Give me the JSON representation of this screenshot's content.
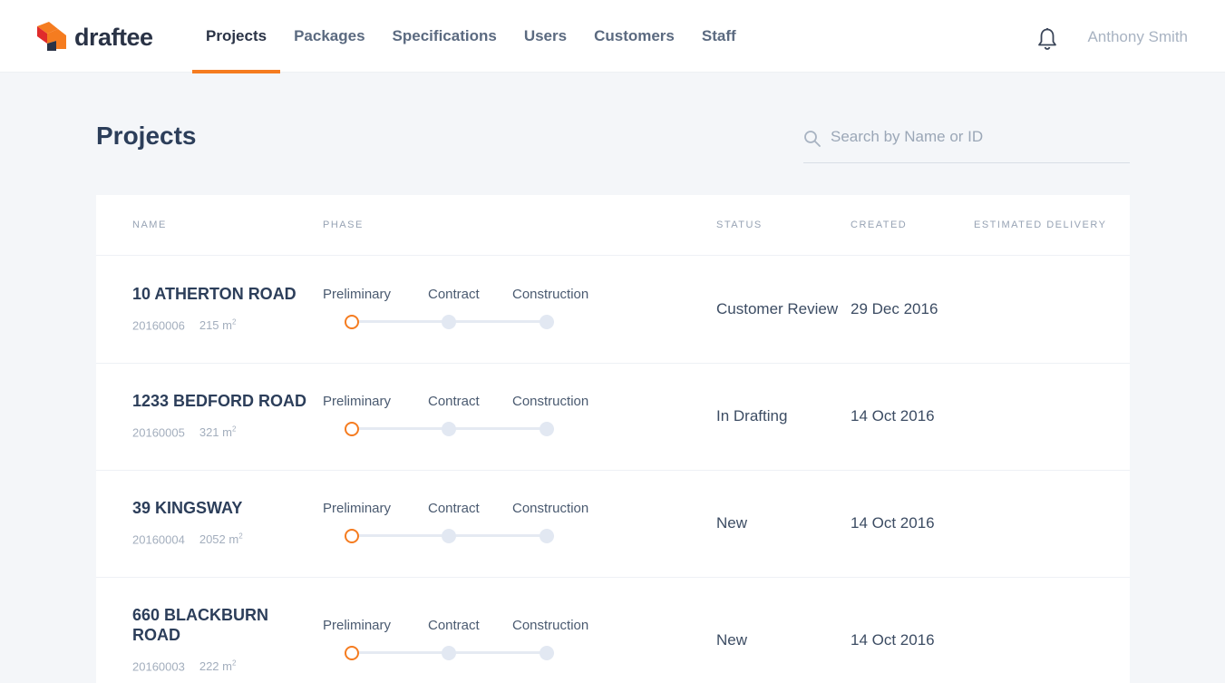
{
  "app": {
    "name": "draftee",
    "colors": {
      "accent": "#f57c20",
      "logo_orange": "#f57c20",
      "logo_red": "#e02b2b",
      "logo_dark": "#2a3346"
    }
  },
  "nav": {
    "items": [
      {
        "label": "Projects",
        "active": true
      },
      {
        "label": "Packages",
        "active": false
      },
      {
        "label": "Specifications",
        "active": false
      },
      {
        "label": "Users",
        "active": false
      },
      {
        "label": "Customers",
        "active": false
      },
      {
        "label": "Staff",
        "active": false
      }
    ]
  },
  "header": {
    "notification_icon": "bell-icon",
    "user_name": "Anthony Smith"
  },
  "page": {
    "title": "Projects"
  },
  "search": {
    "icon": "search-icon",
    "placeholder": "Search by Name or ID",
    "value": ""
  },
  "table": {
    "columns": [
      "NAME",
      "PHASE",
      "STATUS",
      "CREATED",
      "ESTIMATED DELIVERY"
    ],
    "phase_labels": [
      "Preliminary",
      "Contract",
      "Construction"
    ],
    "area_unit": "m",
    "area_unit_sup": "2",
    "rows": [
      {
        "name": "10 ATHERTON ROAD",
        "id": "20160006",
        "area": "215",
        "current_phase": "Preliminary",
        "status": "Customer Review",
        "created": "29 Dec 2016",
        "estimated_delivery": ""
      },
      {
        "name": "1233 BEDFORD ROAD",
        "id": "20160005",
        "area": "321",
        "current_phase": "Preliminary",
        "status": "In Drafting",
        "created": "14 Oct 2016",
        "estimated_delivery": ""
      },
      {
        "name": "39 KINGSWAY",
        "id": "20160004",
        "area": "2052",
        "current_phase": "Preliminary",
        "status": "New",
        "created": "14 Oct 2016",
        "estimated_delivery": ""
      },
      {
        "name": "660 BLACKBURN ROAD",
        "id": "20160003",
        "area": "222",
        "current_phase": "Preliminary",
        "status": "New",
        "created": "14 Oct 2016",
        "estimated_delivery": ""
      }
    ]
  }
}
